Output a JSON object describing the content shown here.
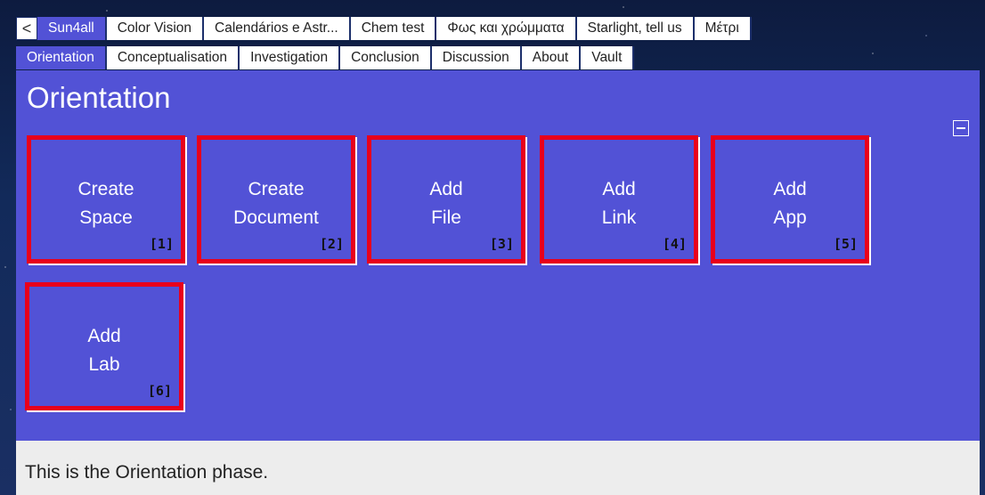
{
  "top_tabs": {
    "back_symbol": "<",
    "items": [
      {
        "label": "Sun4all",
        "active": true
      },
      {
        "label": "Color Vision",
        "active": false
      },
      {
        "label": "Calendários e Astr...",
        "active": false
      },
      {
        "label": "Chem test",
        "active": false
      },
      {
        "label": "Φως και χρώμματα",
        "active": false
      },
      {
        "label": "Starlight, tell us",
        "active": false
      },
      {
        "label": "Μέτρι",
        "active": false
      }
    ]
  },
  "phase_tabs": {
    "items": [
      {
        "label": "Orientation",
        "active": true
      },
      {
        "label": "Conceptualisation",
        "active": false
      },
      {
        "label": "Investigation",
        "active": false
      },
      {
        "label": "Conclusion",
        "active": false
      },
      {
        "label": "Discussion",
        "active": false
      },
      {
        "label": "About",
        "active": false
      },
      {
        "label": "Vault",
        "active": false
      }
    ]
  },
  "panel": {
    "title": "Orientation",
    "collapse_icon": "minus-square-icon",
    "tiles": [
      {
        "line1": "Create",
        "line2": "Space",
        "badge": "[1]"
      },
      {
        "line1": "Create",
        "line2": "Document",
        "badge": "[2]"
      },
      {
        "line1": "Add",
        "line2": "File",
        "badge": "[3]"
      },
      {
        "line1": "Add",
        "line2": "Link",
        "badge": "[4]"
      },
      {
        "line1": "Add",
        "line2": "App",
        "badge": "[5]"
      },
      {
        "line1": "Add",
        "line2": "Lab",
        "badge": "[6]"
      }
    ]
  },
  "description": "This is the Orientation phase.",
  "colors": {
    "accent": "#5252d6",
    "highlight_border": "#e8001c",
    "description_bg": "#ededed"
  }
}
